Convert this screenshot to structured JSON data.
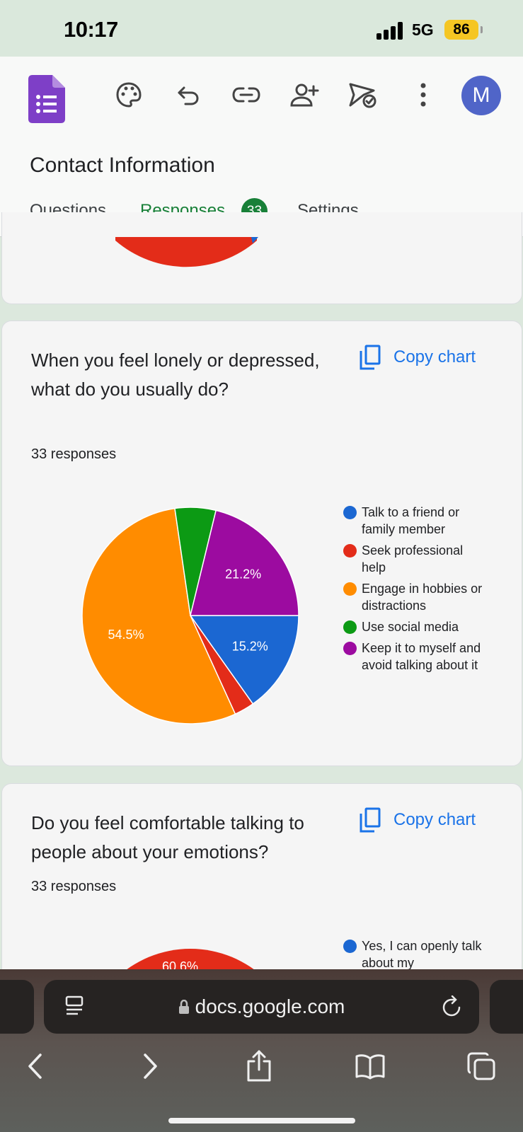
{
  "status": {
    "time": "10:17",
    "network": "5G",
    "battery": "86"
  },
  "header": {
    "form_title": "Contact Information",
    "avatar_letter": "M",
    "tabs": [
      {
        "label": "Questions"
      },
      {
        "label": "Responses",
        "badge": "33",
        "active": true
      },
      {
        "label": "Settings"
      }
    ]
  },
  "cards": [
    {
      "title": "When you feel lonely or depressed, what do you usually do?",
      "responses": "33 responses",
      "copy_label": "Copy chart"
    },
    {
      "title": "Do you feel comfortable talking to people about your emotions?",
      "responses": "33 responses",
      "copy_label": "Copy chart",
      "legend_first": "Yes, I can openly talk about my",
      "visible_pie_label": "60.6%"
    }
  ],
  "chart_data": {
    "type": "pie",
    "slices": [
      {
        "label": "Talk to a friend or family member",
        "value": 15.2,
        "display": "15.2%",
        "color": "#1b67d2"
      },
      {
        "label": "Seek professional help",
        "value": 3.0,
        "display": "",
        "color": "#e32c19"
      },
      {
        "label": "Engage in hobbies or distractions",
        "value": 54.5,
        "display": "54.5%",
        "color": "#ff8c00"
      },
      {
        "label": "Use social media",
        "value": 6.1,
        "display": "",
        "color": "#0c9a14"
      },
      {
        "label": "Keep it to myself and avoid talking about it",
        "value": 21.2,
        "display": "21.2%",
        "color": "#9c0ba0"
      }
    ]
  },
  "browser": {
    "url": "docs.google.com"
  }
}
